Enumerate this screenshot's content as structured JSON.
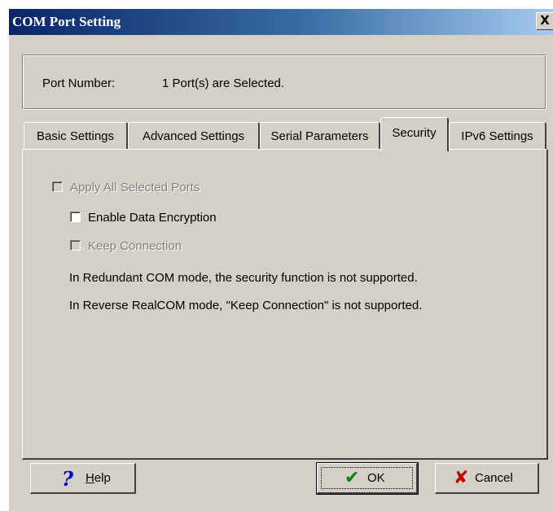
{
  "window": {
    "title": "COM Port Setting",
    "close_glyph": "X"
  },
  "port": {
    "label": "Port Number:",
    "value": "1 Port(s) are Selected."
  },
  "tabs": [
    {
      "label": "Basic Settings",
      "active": false
    },
    {
      "label": "Advanced Settings",
      "active": false
    },
    {
      "label": "Serial Parameters",
      "active": false
    },
    {
      "label": "Security",
      "active": true
    },
    {
      "label": "IPv6 Settings",
      "active": false
    }
  ],
  "security": {
    "apply_all": {
      "label": "Apply All Selected Ports",
      "checked": false,
      "enabled": false
    },
    "enable_encryption": {
      "label": "Enable Data Encryption",
      "checked": false,
      "enabled": true
    },
    "keep_connection": {
      "label": "Keep Connection",
      "checked": false,
      "enabled": false
    },
    "notes": [
      "In Redundant COM mode,  the security function is not supported.",
      "In Reverse RealCOM mode, \"Keep Connection\" is not supported."
    ]
  },
  "buttons": {
    "help": {
      "label": "Help",
      "mnemonic": "H",
      "rest": "elp",
      "icon": "?"
    },
    "ok": {
      "label": "OK",
      "icon": "✔"
    },
    "cancel": {
      "label": "Cancel",
      "icon": "✘"
    }
  },
  "colors": {
    "help_icon": "#0000c0",
    "ok_icon": "#008000",
    "cancel_icon": "#c00000"
  },
  "icons": {
    "help": "question-icon",
    "ok": "checkmark-icon",
    "cancel": "cross-icon",
    "close": "close-icon"
  }
}
